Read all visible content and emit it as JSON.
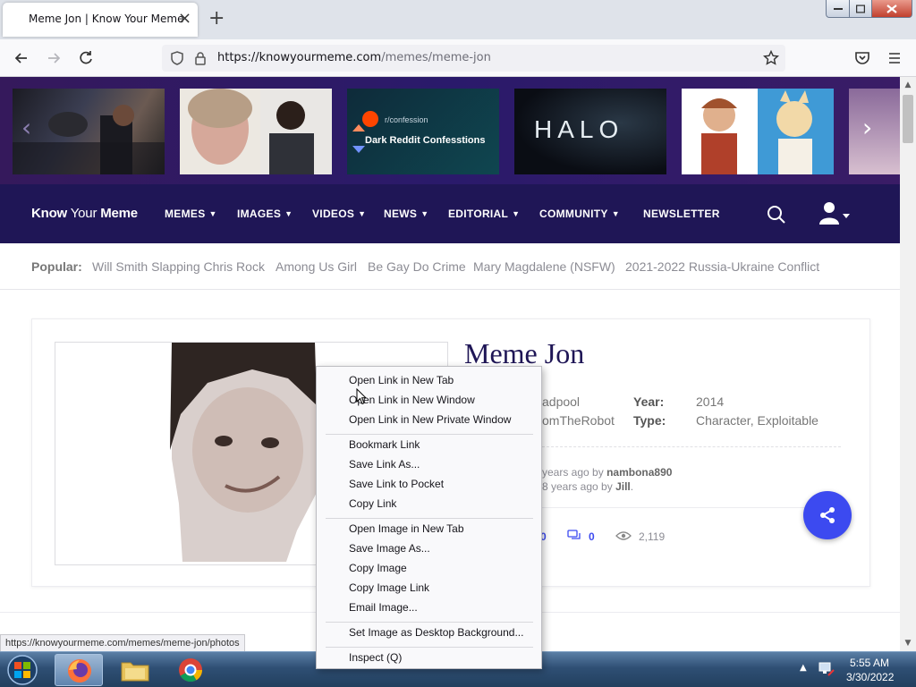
{
  "browser": {
    "tab_title": "Meme Jon | Know Your Meme",
    "url_main": "https://knowyourmeme.com",
    "url_rest": "/memes/meme-jon"
  },
  "carousel": {
    "items": [
      {
        "caption": ""
      },
      {
        "caption": ""
      },
      {
        "caption": "Dark Reddit Confesstions",
        "sub": "r/confession"
      },
      {
        "caption": "HALO"
      },
      {
        "caption": ""
      }
    ]
  },
  "site": {
    "logo_know": "Know",
    "logo_your": "Your",
    "logo_meme": "Meme",
    "nav": [
      "MEMES",
      "IMAGES",
      "VIDEOS",
      "NEWS",
      "EDITORIAL",
      "COMMUNITY",
      "NEWSLETTER"
    ]
  },
  "popular": {
    "label": "Popular:",
    "links": [
      "Will Smith Slapping Chris Rock",
      "Among Us Girl",
      "Be Gay Do Crime",
      "Mary Magdalene (NSFW)",
      "2021-2022 Russia-Ukraine Conflict"
    ]
  },
  "entry": {
    "title": "Meme Jon",
    "partial_1": "adpool",
    "partial_2": "omTheRobot",
    "year_label": "Year:",
    "year_value": "2014",
    "type_label": "Type:",
    "type_value": "Character, Exploitable",
    "updated_prefix": "years ago by",
    "updated_user": "nambona890",
    "added_prefix": "8 years ago by",
    "added_user": "Jill",
    "stat_partial": "0",
    "comments": "0",
    "views": "2,119"
  },
  "context_menu": {
    "items": [
      "Open Link in New Tab",
      "Open Link in New Window",
      "Open Link in New Private Window",
      "Bookmark Link",
      "Save Link As...",
      "Save Link to Pocket",
      "Copy Link",
      "Open Image in New Tab",
      "Save Image As...",
      "Copy Image",
      "Copy Image Link",
      "Email Image...",
      "Set Image as Desktop Background...",
      "Inspect (Q)"
    ]
  },
  "status_bar": {
    "link": "https://knowyourmeme.com/memes/meme-jon/photos"
  },
  "taskbar": {
    "time": "5:55 AM",
    "date": "3/30/2022"
  },
  "colors": {
    "site_nav_bg": "#1f1656",
    "carousel_bg": "#2a1a6b",
    "share_button": "#3c4af0",
    "title": "#1f1656"
  }
}
